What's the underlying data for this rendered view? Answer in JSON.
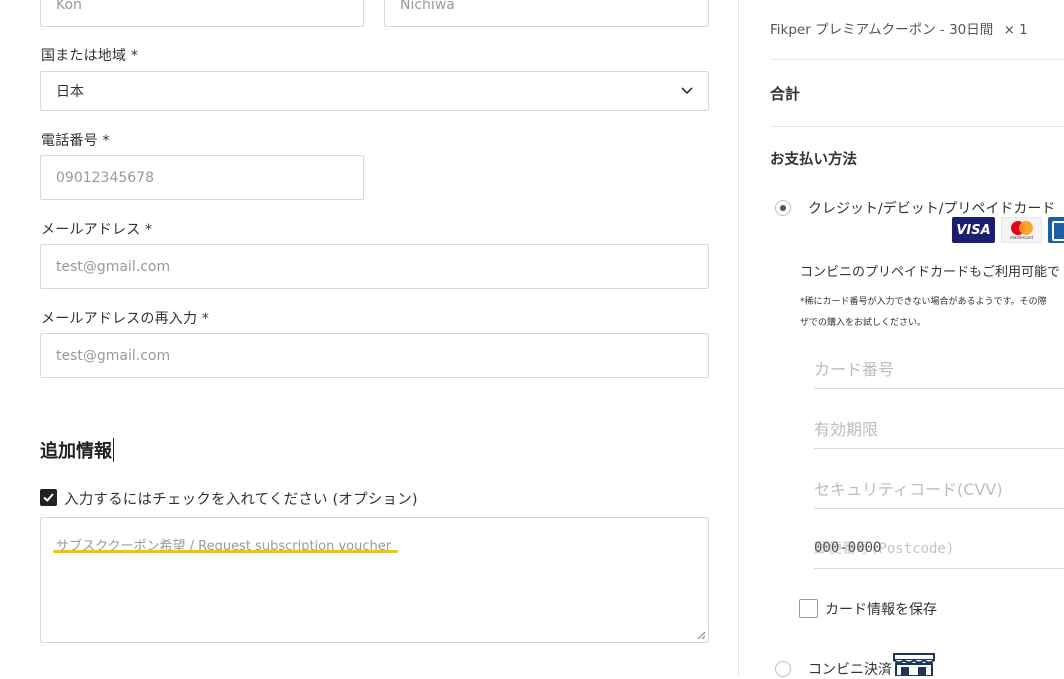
{
  "form": {
    "first_name_value": "Kon",
    "last_name_value": "Nichiwa",
    "country_label": "国または地域 *",
    "country_value": "日本",
    "phone_label": "電話番号 *",
    "phone_placeholder": "09012345678",
    "email_label": "メールアドレス *",
    "email_placeholder": "test@gmail.com",
    "email_confirm_label": "メールアドレスの再入力 *",
    "email_confirm_placeholder": "test@gmail.com"
  },
  "additional": {
    "heading": "追加情報",
    "checkbox_label": "入力するにはチェックを入れてください (オプション)",
    "checkbox_checked": true,
    "textarea_placeholder": "サブスククーポン希望 / Request subscription voucher",
    "highlight_color": "#f5c400"
  },
  "order": {
    "item": "Fikper プレミアムクーポン - 30日間",
    "qty": "× 1",
    "total_label": "合計"
  },
  "payment": {
    "heading": "お支払い方法",
    "card_option_label": "クレジット/デビット/プリペイドカード",
    "card_option_selected": true,
    "brands": [
      "VISA",
      "mastercard"
    ],
    "prepaid_note": "コンビニのプリペイドカードもご利用可能で",
    "small_note_line1": "*稀にカード番号が入力できない場合があるようです。その際",
    "small_note_line2": "ザでの購入をお試しください。",
    "card_number_placeholder": "カード番号",
    "expiry_placeholder": "有効期限",
    "cvv_placeholder": "セキュリティコード(CVV)",
    "postcode_placeholder": "郵便番号(Postcode)",
    "postcode_overlay": "000-0000",
    "save_card_label": "カード情報を保存",
    "konbini_label": "コンビニ決済"
  }
}
